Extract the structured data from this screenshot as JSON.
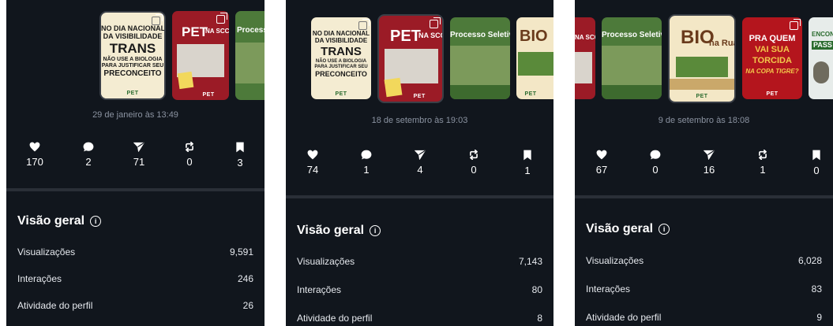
{
  "posts": {
    "trans": {
      "lines": [
        "NO DIA NACIONAL",
        "DA VISIBILIDADE",
        "TRANS",
        "NÃO USE A BIOLOGIA",
        "PARA JUSTIFICAR SEU",
        "PRECONCEITO"
      ]
    },
    "sccud": {
      "title": "PET",
      "subtitle": "NA SCCUD"
    },
    "processo": {
      "title": "Processo Seletivo"
    },
    "bio": {
      "title": "BIO",
      "subtitle": "na Rua!"
    },
    "torcida": {
      "lines": [
        "PRA QUEM",
        "VAI SUA",
        "TORCIDA",
        "NA COPA TIGRE?"
      ]
    },
    "encontro": {
      "lines": [
        "ENCONTRO",
        "PASS"
      ]
    },
    "logo": "PET"
  },
  "panels": [
    {
      "date": "29 de janeiro às 13:49",
      "stats": {
        "likes": "170",
        "comments": "2",
        "shares": "71",
        "reposts": "0",
        "saves": "3"
      },
      "overview_title": "Visão geral",
      "metrics": [
        {
          "label": "Visualizações",
          "value": "9,591"
        },
        {
          "label": "Interações",
          "value": "246"
        },
        {
          "label": "Atividade do perfil",
          "value": "26"
        }
      ]
    },
    {
      "date": "18 de setembro às 19:03",
      "stats": {
        "likes": "74",
        "comments": "1",
        "shares": "4",
        "reposts": "0",
        "saves": "1"
      },
      "overview_title": "Visão geral",
      "metrics": [
        {
          "label": "Visualizações",
          "value": "7,143"
        },
        {
          "label": "Interações",
          "value": "80"
        },
        {
          "label": "Atividade do perfil",
          "value": "8"
        }
      ]
    },
    {
      "date": "9 de setembro às 18:08",
      "stats": {
        "likes": "67",
        "comments": "0",
        "shares": "16",
        "reposts": "1",
        "saves": "0"
      },
      "overview_title": "Visão geral",
      "metrics": [
        {
          "label": "Visualizações",
          "value": "6,028"
        },
        {
          "label": "Interações",
          "value": "83"
        },
        {
          "label": "Atividade do perfil",
          "value": "9"
        }
      ]
    }
  ],
  "colors": {
    "background": "#11161d",
    "divider": "#2a2f37",
    "muted_text": "#8b93a1",
    "trans_post_bg": "#f4ecd2",
    "sccud_post_bg": "#9b1b26",
    "processo_post_bg": "#4d7a3a",
    "bio_post_bg": "#f3e7c6",
    "torcida_post_bg": "#b4151d"
  },
  "icons": [
    "heart-icon",
    "comment-icon",
    "send-icon",
    "repost-icon",
    "bookmark-icon",
    "info-icon",
    "multiple-images-icon"
  ]
}
